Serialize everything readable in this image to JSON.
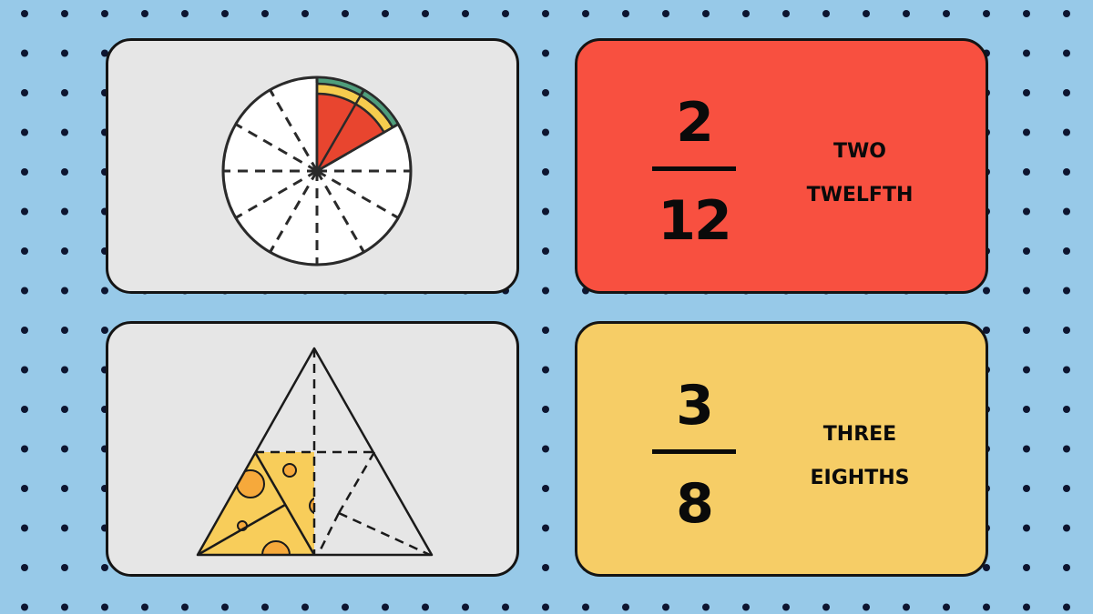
{
  "background": {
    "color": "#97c9e8",
    "dot_color": "#0d1530",
    "pattern": "polka-dot-grid"
  },
  "cards": [
    {
      "id": "pie",
      "kind": "illustration",
      "shape": "circle",
      "total_parts": 12,
      "shaded_parts": 2,
      "fill": "#e6e6e6",
      "slice_colors": {
        "sauce": "#e8452f",
        "cheese": "#f6cc4e",
        "crust": "#4f9e7c"
      }
    },
    {
      "id": "fraction-1",
      "numerator": "2",
      "denominator": "12",
      "words": [
        "TWO",
        "TWELFTH"
      ],
      "fill": "#f85040"
    },
    {
      "id": "triangle",
      "kind": "illustration",
      "shape": "triangle",
      "total_parts": 8,
      "shaded_parts": 3,
      "fill": "#e6e6e6",
      "shade_color": "#f8cd5a",
      "hole_color": "#f6a93b"
    },
    {
      "id": "fraction-2",
      "numerator": "3",
      "denominator": "8",
      "words": [
        "THREE",
        "EIGHTHS"
      ],
      "fill": "#f6cd66"
    }
  ]
}
